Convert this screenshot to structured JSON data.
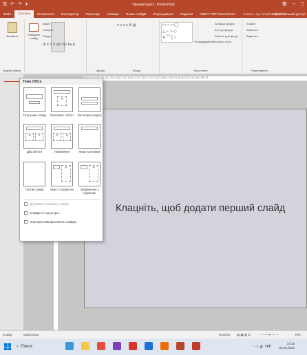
{
  "window": {
    "title": "Презентація1 - PowerPoint",
    "qat": [
      "↶",
      "↷",
      "⟳"
    ]
  },
  "tabs": [
    {
      "label": "Файл"
    },
    {
      "label": "Основне"
    },
    {
      "label": "Вставлення"
    },
    {
      "label": "Конструктор"
    },
    {
      "label": "Переходи"
    },
    {
      "label": "Анімація"
    },
    {
      "label": "Показ слайдів"
    },
    {
      "label": "Рецензування"
    },
    {
      "label": "Подання"
    },
    {
      "label": "ABBYY PDF Transformer+"
    }
  ],
  "tell_me": "Скажіть, що потрібно зробити...",
  "account": "Увійти  Спільний доступ",
  "ribbon": {
    "paste": "Вставити",
    "clipboard": "Буфер обміну",
    "new_slide": "Створити слайд",
    "layout": "Макет",
    "reset": "Скинути",
    "section": "Розділ",
    "slides_group": "Слайди",
    "font_group": "Шрифт",
    "paragraph_group": "Абзац",
    "drawing_group": "Креслення",
    "editing_group": "Редагування",
    "arrange": "Упорядкування",
    "quick_styles": "Експрес-стилі",
    "shape_fill": "Заливка фігури",
    "shape_outline": "Контур фігури",
    "shape_effects": "Ефекти для фігур",
    "find": "Знайти",
    "replace": "Замінити",
    "select": "Виділити",
    "font_row": "Ж  К  Ч  S  abc  AV  Aa  A",
    "para_row": "≡  ≡  ≡  ≡  ≣  ▤"
  },
  "ruler_text": "16 | 15 | 14 | 13 | 12 | 11 | 10 | 9 | 8 | 7 | 6 | 5 | 4 | 3 | 2 | 1 | 0 | 1 | 2 | 3 | 4 | 5 | 6 | 7 | 8 | 9 | 10 | 11 | 12 | 13 | 14 | 15 | 16",
  "vruler_text": "8 7 6 5 4 3 2 1 0 1 2 3 4 5 6 7 8",
  "dropdown": {
    "header": "Тема Office",
    "layouts": [
      {
        "label": "Титульний слайд"
      },
      {
        "label": "Заголовок і об'єкт"
      },
      {
        "label": "Заголовок розділу"
      },
      {
        "label": "Два об'єкти"
      },
      {
        "label": "Порівняння"
      },
      {
        "label": "Лише заголовок"
      },
      {
        "label": "Пустий слайд"
      },
      {
        "label": "Вміст із підписом"
      },
      {
        "label": "Зображення з підписом"
      }
    ],
    "duplicate": "Дублювати вибрані слайди",
    "outline": "Слайди зі структури...",
    "reuse": "Повторне використання слайдів..."
  },
  "slide": {
    "placeholder": "Клацніть, щоб додати перший слайд"
  },
  "status": {
    "slide": "Слайд",
    "language": "українська",
    "notes": "Нотатки",
    "zoom": "78%"
  },
  "taskbar": {
    "search": "Поиск",
    "lang": "УКР",
    "time": "23:15",
    "date": "02.09.2023"
  }
}
